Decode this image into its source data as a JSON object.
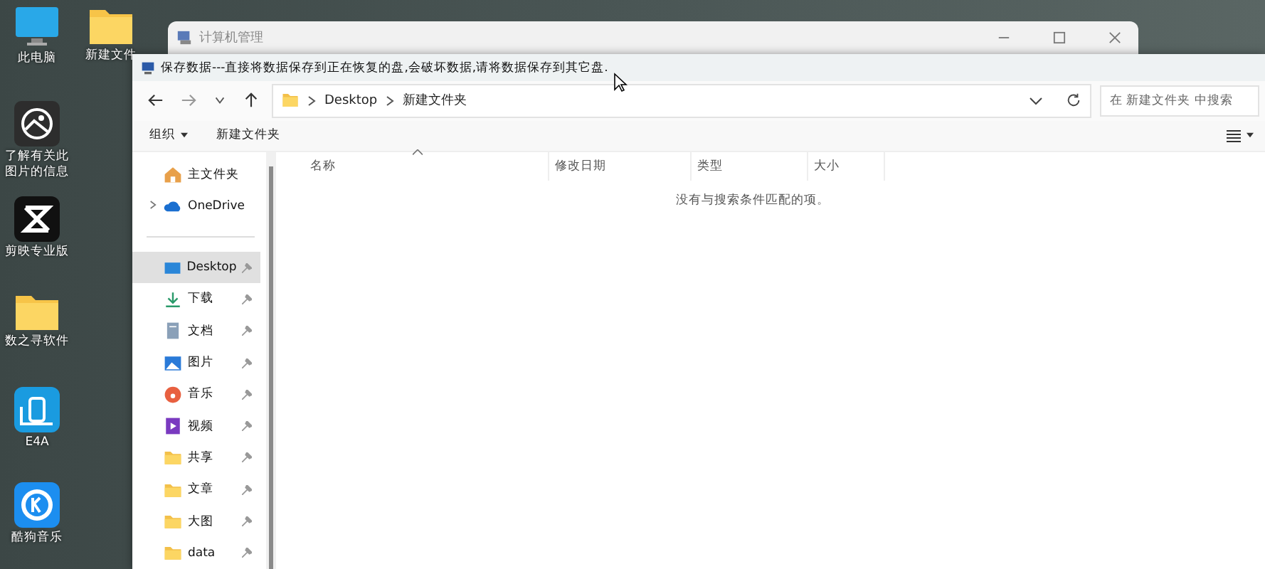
{
  "desktop_icons": {
    "column_1": [
      {
        "kind": "monitor",
        "label": "此电脑"
      },
      {
        "kind": "info",
        "label": "了解有关此图片的信息"
      },
      {
        "kind": "capcut",
        "label": "剪映专业版"
      },
      {
        "kind": "folder",
        "label": "数之寻软件"
      },
      {
        "kind": "e4a",
        "label": "E4A"
      },
      {
        "kind": "kugou",
        "label": "酷狗音乐"
      }
    ],
    "column_2": [
      {
        "kind": "folder",
        "label": "新建文件"
      }
    ]
  },
  "background_window": {
    "title": "计算机管理"
  },
  "dialog": {
    "title": "保存数据---直接将数据保存到正在恢复的盘,会破坏数据,请将数据保存到其它盘.",
    "breadcrumb": [
      "Desktop",
      "新建文件夹"
    ],
    "search": {
      "placeholder": "在 新建文件夹 中搜索"
    },
    "toolbar": {
      "organize": "组织",
      "new_folder": "新建文件夹"
    },
    "nav": [
      {
        "kind": "home",
        "label": "主文件夹",
        "expandable": false,
        "pinned": false,
        "selected": false
      },
      {
        "kind": "cloud",
        "label": "OneDrive",
        "expandable": true,
        "pinned": false,
        "selected": false
      },
      {
        "kind": "divider"
      },
      {
        "kind": "desktop",
        "label": "Desktop",
        "expandable": false,
        "pinned": true,
        "selected": true
      },
      {
        "kind": "download",
        "label": "下载",
        "expandable": false,
        "pinned": true,
        "selected": false
      },
      {
        "kind": "docs",
        "label": "文档",
        "expandable": false,
        "pinned": true,
        "selected": false
      },
      {
        "kind": "pictures",
        "label": "图片",
        "expandable": false,
        "pinned": true,
        "selected": false
      },
      {
        "kind": "music",
        "label": "音乐",
        "expandable": false,
        "pinned": true,
        "selected": false
      },
      {
        "kind": "video",
        "label": "视频",
        "expandable": false,
        "pinned": true,
        "selected": false
      },
      {
        "kind": "folder",
        "label": "共享",
        "expandable": false,
        "pinned": true,
        "selected": false
      },
      {
        "kind": "folder",
        "label": "文章",
        "expandable": false,
        "pinned": true,
        "selected": false
      },
      {
        "kind": "folder",
        "label": "大图",
        "expandable": false,
        "pinned": true,
        "selected": false
      },
      {
        "kind": "folder",
        "label": "data",
        "expandable": false,
        "pinned": true,
        "selected": false
      }
    ],
    "columns": [
      {
        "label": "名称",
        "sorted": true
      },
      {
        "label": "修改日期",
        "sorted": false
      },
      {
        "label": "类型",
        "sorted": false
      },
      {
        "label": "大小",
        "sorted": false
      }
    ],
    "empty_message": "没有与搜索条件匹配的项。"
  }
}
